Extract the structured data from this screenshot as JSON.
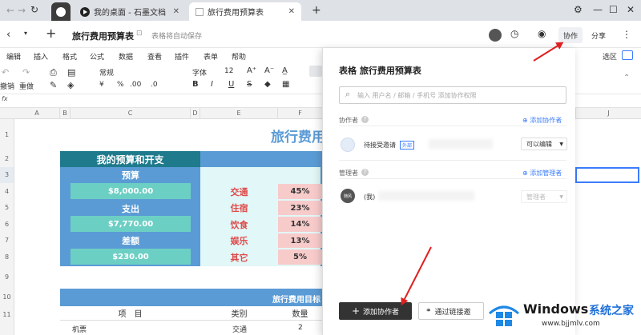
{
  "browser": {
    "tabs": [
      {
        "label": "我的桌面 - 石墨文档",
        "close": "✕"
      },
      {
        "label": "旅行费用预算表",
        "close": "✕"
      }
    ],
    "new_tab": "+"
  },
  "doc": {
    "title": "旅行费用预算表",
    "autosave": "表格将自动保存",
    "collab_btn": "协作",
    "share_btn": "分享"
  },
  "menu": [
    "编辑",
    "插入",
    "格式",
    "公式",
    "数据",
    "查看",
    "插件",
    "表单",
    "帮助"
  ],
  "toolbar": {
    "undo": "撤销",
    "redo": "重做",
    "format": "常规",
    "currency": "¥",
    "percent": "%",
    "dec1": ".00",
    "dec2": ".0",
    "font": "字体",
    "size": "12",
    "right_label": "选区"
  },
  "formula_bar": "fx",
  "columns": [
    "A",
    "B",
    "C",
    "D",
    "E",
    "F",
    "J"
  ],
  "rows": [
    "1",
    "2",
    "3",
    "4",
    "5",
    "6",
    "7",
    "8",
    "9",
    "10",
    "11"
  ],
  "sheet": {
    "title": "旅行费用",
    "left_header": "我的预算和开支",
    "budget_label": "预算",
    "budget_value": "$8,000.00",
    "spend_label": "支出",
    "spend_value": "$7,770.00",
    "diff_label": "差额",
    "diff_value": "$230.00",
    "categories": [
      {
        "name": "交通",
        "pct": "45%"
      },
      {
        "name": "住宿",
        "pct": "23%"
      },
      {
        "name": "饮食",
        "pct": "14%"
      },
      {
        "name": "娱乐",
        "pct": "13%"
      },
      {
        "name": "其它",
        "pct": "5%"
      }
    ],
    "detail_title": "旅行费用目标",
    "detail_headers": [
      "项　目",
      "类别",
      "数量"
    ],
    "detail_row": [
      "机票",
      "交通",
      "2"
    ]
  },
  "panel": {
    "title": "表格 旅行费用预算表",
    "search_placeholder": "输入 用户名 / 邮箱 / 手机号 添加协作权限",
    "collaborators_label": "协作者",
    "add_collaborator_link": "添加协作者",
    "pending_user": "待接受邀请",
    "external_badge": "外部",
    "permission": "可以编辑",
    "managers_label": "管理者",
    "add_manager_link": "添加管理者",
    "me": "(我)",
    "manager_role": "管理者",
    "avatar_text": "随风",
    "add_btn": "添加协作者",
    "link_btn": "通过链接邀"
  },
  "watermark": {
    "brand": "Windows",
    "cn": "系统之家",
    "url": "www.bjjmlv.com"
  },
  "colors": {
    "teal_header": "#1f7a8c",
    "blue_block": "#5b9bd5",
    "teal_value": "#6ccfc4",
    "pink_pct": "#f8cbcb",
    "red_text": "#e04a4a",
    "panel_link": "#3b7cff",
    "dark_btn": "#333333"
  }
}
